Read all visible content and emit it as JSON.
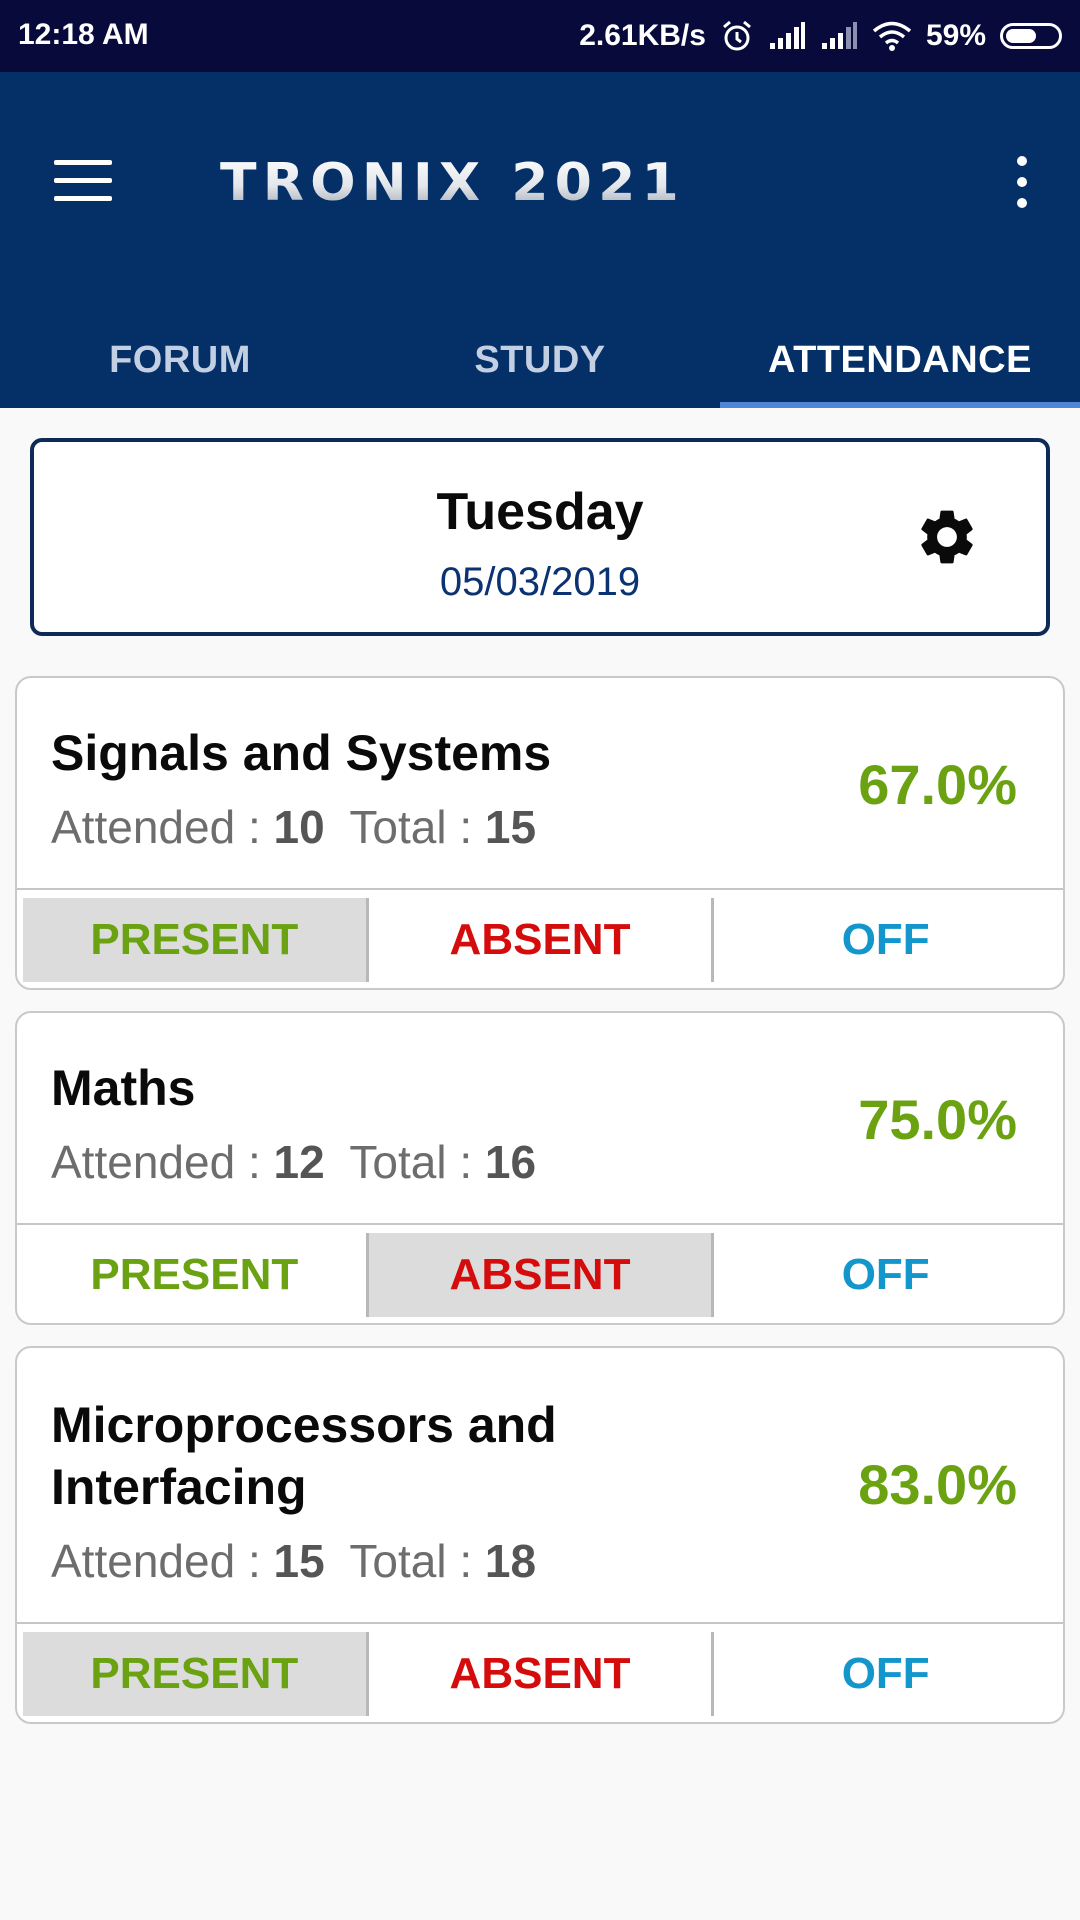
{
  "status_bar": {
    "time": "12:18 AM",
    "network_speed": "2.61KB/s",
    "battery_percent": "59%",
    "battery_level": 0.59,
    "icons": [
      "alarm-icon",
      "signal-icon",
      "signal-icon",
      "wifi-icon",
      "battery-icon"
    ]
  },
  "app_bar": {
    "logo_text": "TRONIX 2021",
    "menu_icon": "hamburger-menu-icon",
    "more_icon": "more-vert-icon",
    "colors": {
      "status_bar": "#070a3b",
      "app_bar": "#053067",
      "tab_indicator": "#4f86d8"
    }
  },
  "tabs": [
    {
      "label": "FORUM",
      "active": false
    },
    {
      "label": "STUDY",
      "active": false
    },
    {
      "label": "ATTENDANCE",
      "active": true
    }
  ],
  "date_card": {
    "day": "Tuesday",
    "date": "05/03/2019",
    "settings_icon": "gear-icon"
  },
  "labels": {
    "attended": "Attended :",
    "total": "Total :",
    "present": "PRESENT",
    "absent": "ABSENT",
    "off": "OFF"
  },
  "colors": {
    "present": "#6aa211",
    "absent": "#d50c0c",
    "off": "#1396cc",
    "percent": "#6aa211"
  },
  "subjects": [
    {
      "name": "Signals and Systems",
      "attended": "10",
      "total": "15",
      "percent": "67.0%",
      "selected": "present"
    },
    {
      "name": "Maths",
      "attended": "12",
      "total": "16",
      "percent": "75.0%",
      "selected": "absent"
    },
    {
      "name": "Microprocessors and Interfacing",
      "attended": "15",
      "total": "18",
      "percent": "83.0%",
      "selected": "present"
    }
  ]
}
